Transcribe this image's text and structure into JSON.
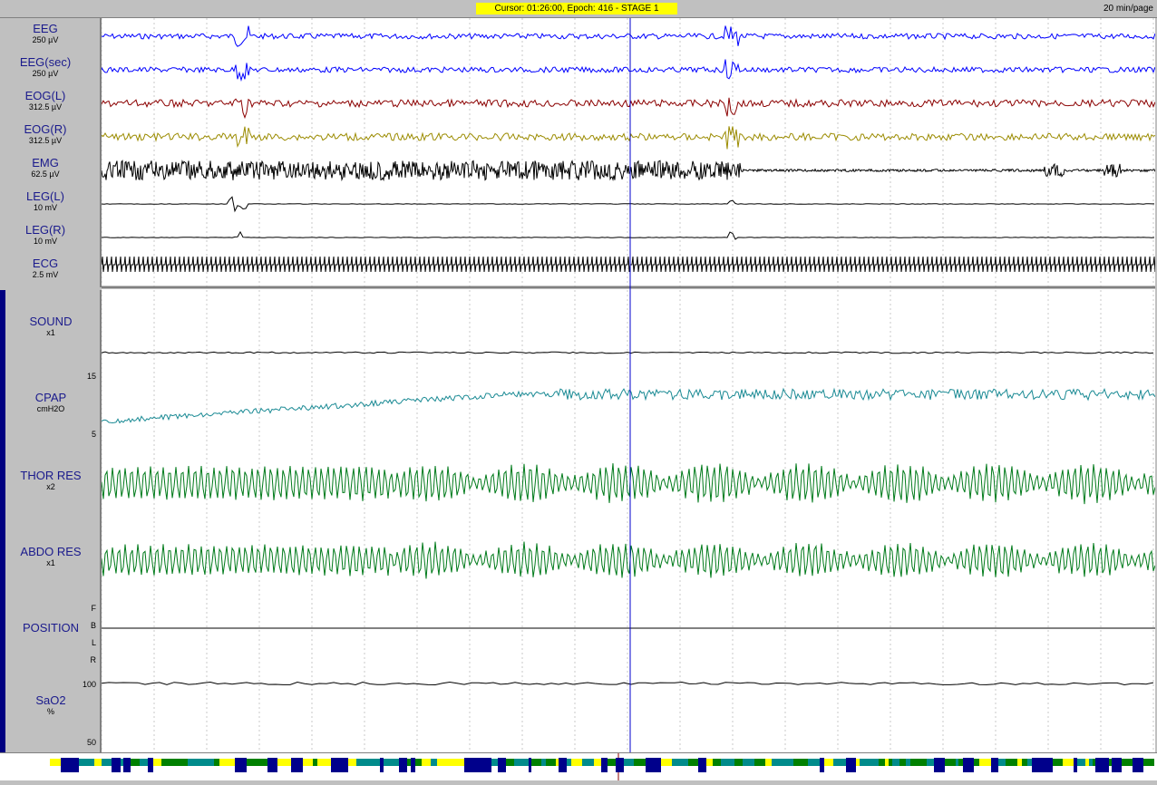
{
  "header": {
    "cursor_text": "Cursor: 01:26:00, Epoch: 416  - STAGE 1",
    "page_scale": "20 min/page"
  },
  "channels_top": [
    {
      "name": "EEG",
      "scale": "250 µV",
      "color": "#0000ff"
    },
    {
      "name": "EEG(sec)",
      "scale": "250 µV",
      "color": "#0000ff"
    },
    {
      "name": "EOG(L)",
      "scale": "312.5 µV",
      "color": "#8b0000"
    },
    {
      "name": "EOG(R)",
      "scale": "312.5 µV",
      "color": "#9b8b00"
    },
    {
      "name": "EMG",
      "scale": "62.5 µV",
      "color": "#000000"
    },
    {
      "name": "LEG(L)",
      "scale": "10 mV",
      "color": "#000000"
    },
    {
      "name": "LEG(R)",
      "scale": "10 mV",
      "color": "#000000"
    },
    {
      "name": "ECG",
      "scale": "2.5 mV",
      "color": "#000000"
    }
  ],
  "channels_bottom": [
    {
      "name": "SOUND",
      "scale": "x1",
      "color": "#000000"
    },
    {
      "name": "CPAP",
      "scale": "cmH2O",
      "color": "#1a8a94"
    },
    {
      "name": "THOR RES",
      "scale": "x2",
      "color": "#007a1a"
    },
    {
      "name": "ABDO RES",
      "scale": "x1",
      "color": "#007a1a"
    },
    {
      "name": "POSITION",
      "scale": "",
      "color": "#000000"
    },
    {
      "name": "SaO2",
      "scale": "%",
      "color": "#000000"
    }
  ],
  "axis_ticks": {
    "cpap_max": "15",
    "cpap_min": "5",
    "position_labels": [
      "F",
      "B",
      "L",
      "R"
    ],
    "sao2_max": "100",
    "sao2_min": "50"
  },
  "colors": {
    "cursor_line": "#0000cc",
    "highlight": "#ffff00",
    "hypno_wake": "#ffff00",
    "hypno_stage1": "#008000",
    "hypno_stage2": "#008b8b",
    "hypno_rem": "#00008b",
    "hypno_arousal": "#8b0000"
  }
}
